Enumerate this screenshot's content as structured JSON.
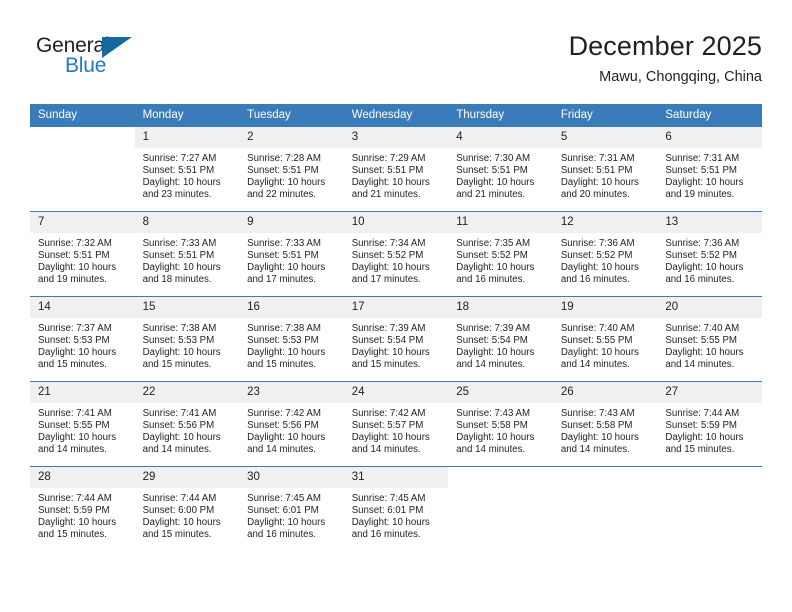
{
  "brand": {
    "name_dark": "General",
    "name_light": "Blue",
    "triangle_icon": "triangle-icon",
    "accent_color": "#1f7cc1",
    "triangle_color": "#15699f"
  },
  "header": {
    "title": "December 2025",
    "subtitle": "Mawu, Chongqing, China"
  },
  "calendar": {
    "header_bg": "#3a7cb9",
    "daynum_bg": "#f0f0f0",
    "weekday_headers": [
      "Sunday",
      "Monday",
      "Tuesday",
      "Wednesday",
      "Thursday",
      "Friday",
      "Saturday"
    ],
    "weeks": [
      [
        {
          "day": "",
          "sunrise": "",
          "sunset": "",
          "daylight_line1": "",
          "daylight_line2": ""
        },
        {
          "day": "1",
          "sunrise": "Sunrise: 7:27 AM",
          "sunset": "Sunset: 5:51 PM",
          "daylight_line1": "Daylight: 10 hours",
          "daylight_line2": "and 23 minutes."
        },
        {
          "day": "2",
          "sunrise": "Sunrise: 7:28 AM",
          "sunset": "Sunset: 5:51 PM",
          "daylight_line1": "Daylight: 10 hours",
          "daylight_line2": "and 22 minutes."
        },
        {
          "day": "3",
          "sunrise": "Sunrise: 7:29 AM",
          "sunset": "Sunset: 5:51 PM",
          "daylight_line1": "Daylight: 10 hours",
          "daylight_line2": "and 21 minutes."
        },
        {
          "day": "4",
          "sunrise": "Sunrise: 7:30 AM",
          "sunset": "Sunset: 5:51 PM",
          "daylight_line1": "Daylight: 10 hours",
          "daylight_line2": "and 21 minutes."
        },
        {
          "day": "5",
          "sunrise": "Sunrise: 7:31 AM",
          "sunset": "Sunset: 5:51 PM",
          "daylight_line1": "Daylight: 10 hours",
          "daylight_line2": "and 20 minutes."
        },
        {
          "day": "6",
          "sunrise": "Sunrise: 7:31 AM",
          "sunset": "Sunset: 5:51 PM",
          "daylight_line1": "Daylight: 10 hours",
          "daylight_line2": "and 19 minutes."
        }
      ],
      [
        {
          "day": "7",
          "sunrise": "Sunrise: 7:32 AM",
          "sunset": "Sunset: 5:51 PM",
          "daylight_line1": "Daylight: 10 hours",
          "daylight_line2": "and 19 minutes."
        },
        {
          "day": "8",
          "sunrise": "Sunrise: 7:33 AM",
          "sunset": "Sunset: 5:51 PM",
          "daylight_line1": "Daylight: 10 hours",
          "daylight_line2": "and 18 minutes."
        },
        {
          "day": "9",
          "sunrise": "Sunrise: 7:33 AM",
          "sunset": "Sunset: 5:51 PM",
          "daylight_line1": "Daylight: 10 hours",
          "daylight_line2": "and 17 minutes."
        },
        {
          "day": "10",
          "sunrise": "Sunrise: 7:34 AM",
          "sunset": "Sunset: 5:52 PM",
          "daylight_line1": "Daylight: 10 hours",
          "daylight_line2": "and 17 minutes."
        },
        {
          "day": "11",
          "sunrise": "Sunrise: 7:35 AM",
          "sunset": "Sunset: 5:52 PM",
          "daylight_line1": "Daylight: 10 hours",
          "daylight_line2": "and 16 minutes."
        },
        {
          "day": "12",
          "sunrise": "Sunrise: 7:36 AM",
          "sunset": "Sunset: 5:52 PM",
          "daylight_line1": "Daylight: 10 hours",
          "daylight_line2": "and 16 minutes."
        },
        {
          "day": "13",
          "sunrise": "Sunrise: 7:36 AM",
          "sunset": "Sunset: 5:52 PM",
          "daylight_line1": "Daylight: 10 hours",
          "daylight_line2": "and 16 minutes."
        }
      ],
      [
        {
          "day": "14",
          "sunrise": "Sunrise: 7:37 AM",
          "sunset": "Sunset: 5:53 PM",
          "daylight_line1": "Daylight: 10 hours",
          "daylight_line2": "and 15 minutes."
        },
        {
          "day": "15",
          "sunrise": "Sunrise: 7:38 AM",
          "sunset": "Sunset: 5:53 PM",
          "daylight_line1": "Daylight: 10 hours",
          "daylight_line2": "and 15 minutes."
        },
        {
          "day": "16",
          "sunrise": "Sunrise: 7:38 AM",
          "sunset": "Sunset: 5:53 PM",
          "daylight_line1": "Daylight: 10 hours",
          "daylight_line2": "and 15 minutes."
        },
        {
          "day": "17",
          "sunrise": "Sunrise: 7:39 AM",
          "sunset": "Sunset: 5:54 PM",
          "daylight_line1": "Daylight: 10 hours",
          "daylight_line2": "and 15 minutes."
        },
        {
          "day": "18",
          "sunrise": "Sunrise: 7:39 AM",
          "sunset": "Sunset: 5:54 PM",
          "daylight_line1": "Daylight: 10 hours",
          "daylight_line2": "and 14 minutes."
        },
        {
          "day": "19",
          "sunrise": "Sunrise: 7:40 AM",
          "sunset": "Sunset: 5:55 PM",
          "daylight_line1": "Daylight: 10 hours",
          "daylight_line2": "and 14 minutes."
        },
        {
          "day": "20",
          "sunrise": "Sunrise: 7:40 AM",
          "sunset": "Sunset: 5:55 PM",
          "daylight_line1": "Daylight: 10 hours",
          "daylight_line2": "and 14 minutes."
        }
      ],
      [
        {
          "day": "21",
          "sunrise": "Sunrise: 7:41 AM",
          "sunset": "Sunset: 5:55 PM",
          "daylight_line1": "Daylight: 10 hours",
          "daylight_line2": "and 14 minutes."
        },
        {
          "day": "22",
          "sunrise": "Sunrise: 7:41 AM",
          "sunset": "Sunset: 5:56 PM",
          "daylight_line1": "Daylight: 10 hours",
          "daylight_line2": "and 14 minutes."
        },
        {
          "day": "23",
          "sunrise": "Sunrise: 7:42 AM",
          "sunset": "Sunset: 5:56 PM",
          "daylight_line1": "Daylight: 10 hours",
          "daylight_line2": "and 14 minutes."
        },
        {
          "day": "24",
          "sunrise": "Sunrise: 7:42 AM",
          "sunset": "Sunset: 5:57 PM",
          "daylight_line1": "Daylight: 10 hours",
          "daylight_line2": "and 14 minutes."
        },
        {
          "day": "25",
          "sunrise": "Sunrise: 7:43 AM",
          "sunset": "Sunset: 5:58 PM",
          "daylight_line1": "Daylight: 10 hours",
          "daylight_line2": "and 14 minutes."
        },
        {
          "day": "26",
          "sunrise": "Sunrise: 7:43 AM",
          "sunset": "Sunset: 5:58 PM",
          "daylight_line1": "Daylight: 10 hours",
          "daylight_line2": "and 14 minutes."
        },
        {
          "day": "27",
          "sunrise": "Sunrise: 7:44 AM",
          "sunset": "Sunset: 5:59 PM",
          "daylight_line1": "Daylight: 10 hours",
          "daylight_line2": "and 15 minutes."
        }
      ],
      [
        {
          "day": "28",
          "sunrise": "Sunrise: 7:44 AM",
          "sunset": "Sunset: 5:59 PM",
          "daylight_line1": "Daylight: 10 hours",
          "daylight_line2": "and 15 minutes."
        },
        {
          "day": "29",
          "sunrise": "Sunrise: 7:44 AM",
          "sunset": "Sunset: 6:00 PM",
          "daylight_line1": "Daylight: 10 hours",
          "daylight_line2": "and 15 minutes."
        },
        {
          "day": "30",
          "sunrise": "Sunrise: 7:45 AM",
          "sunset": "Sunset: 6:01 PM",
          "daylight_line1": "Daylight: 10 hours",
          "daylight_line2": "and 16 minutes."
        },
        {
          "day": "31",
          "sunrise": "Sunrise: 7:45 AM",
          "sunset": "Sunset: 6:01 PM",
          "daylight_line1": "Daylight: 10 hours",
          "daylight_line2": "and 16 minutes."
        },
        {
          "day": "",
          "sunrise": "",
          "sunset": "",
          "daylight_line1": "",
          "daylight_line2": ""
        },
        {
          "day": "",
          "sunrise": "",
          "sunset": "",
          "daylight_line1": "",
          "daylight_line2": ""
        },
        {
          "day": "",
          "sunrise": "",
          "sunset": "",
          "daylight_line1": "",
          "daylight_line2": ""
        }
      ]
    ]
  }
}
